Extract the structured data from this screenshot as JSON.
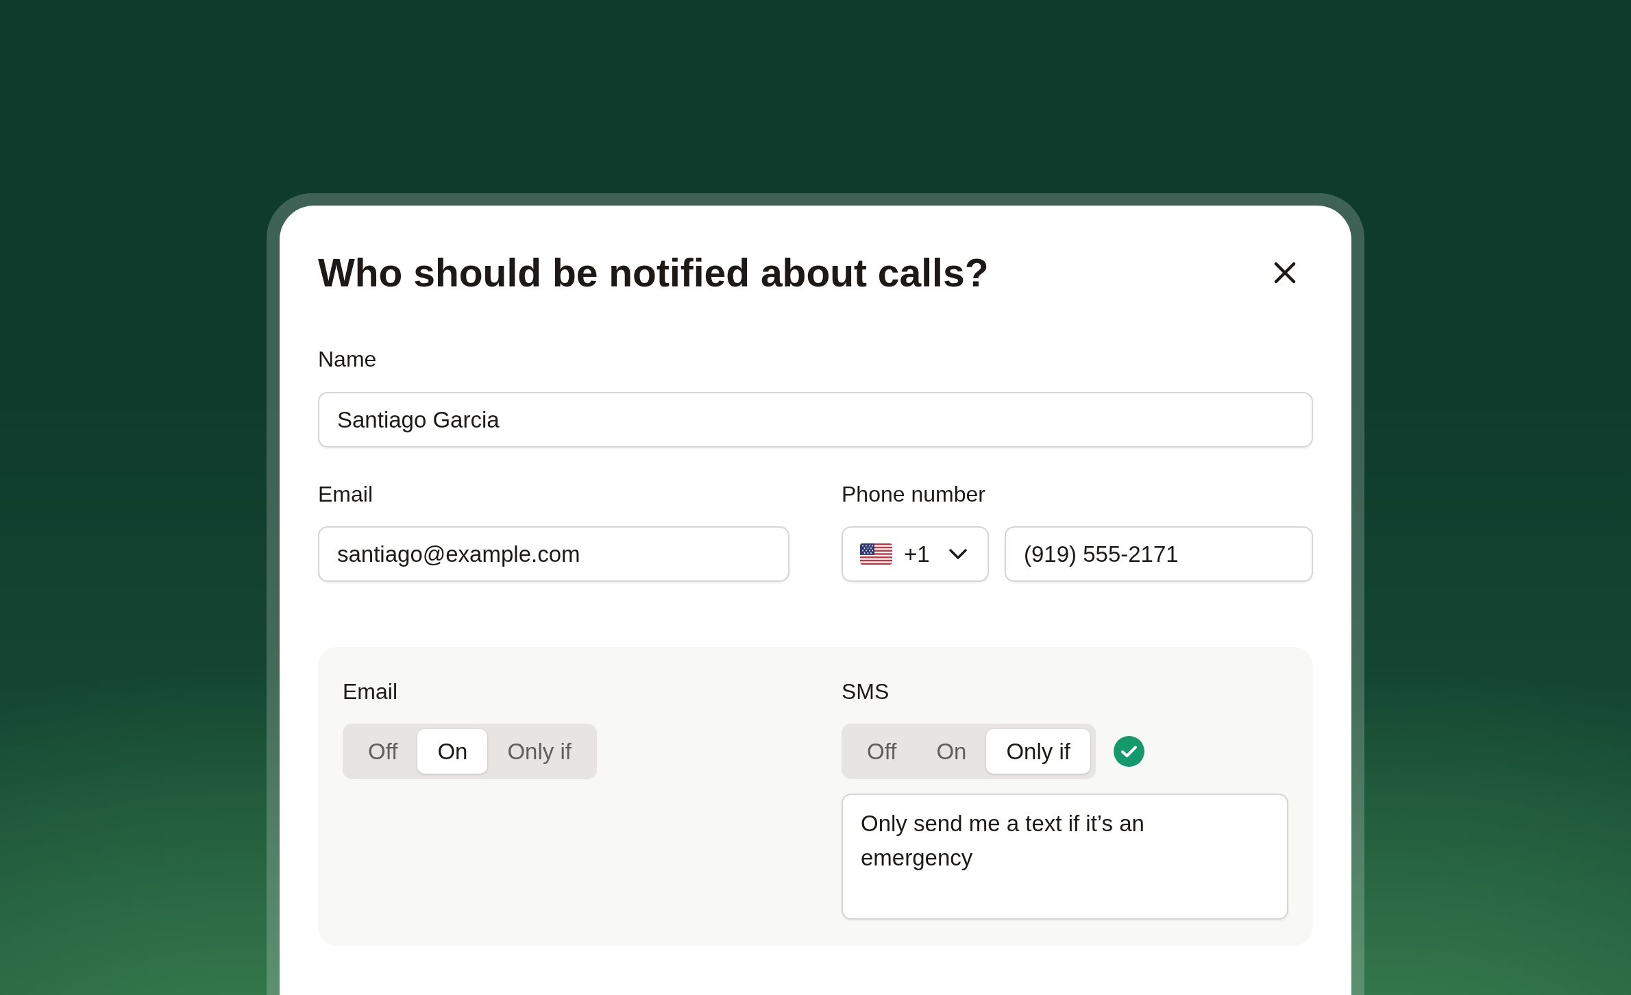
{
  "dialog": {
    "title": "Who should be notified about calls?"
  },
  "name_field": {
    "label": "Name",
    "value": "Santiago Garcia"
  },
  "email_field": {
    "label": "Email",
    "value": "santiago@example.com"
  },
  "phone_field": {
    "label": "Phone number",
    "country_code": "+1",
    "value": "(919) 555-2171"
  },
  "notifications": [
    {
      "channel": "Email",
      "options": [
        {
          "label": "Off",
          "selected": false
        },
        {
          "label": "On",
          "selected": true
        },
        {
          "label": "Only if",
          "selected": false
        }
      ]
    },
    {
      "channel": "SMS",
      "options": [
        {
          "label": "Off",
          "selected": false
        },
        {
          "label": "On",
          "selected": false
        },
        {
          "label": "Only if",
          "selected": true
        }
      ],
      "confirmed": true,
      "condition": "Only send me a text if it’s an emergency"
    }
  ]
}
